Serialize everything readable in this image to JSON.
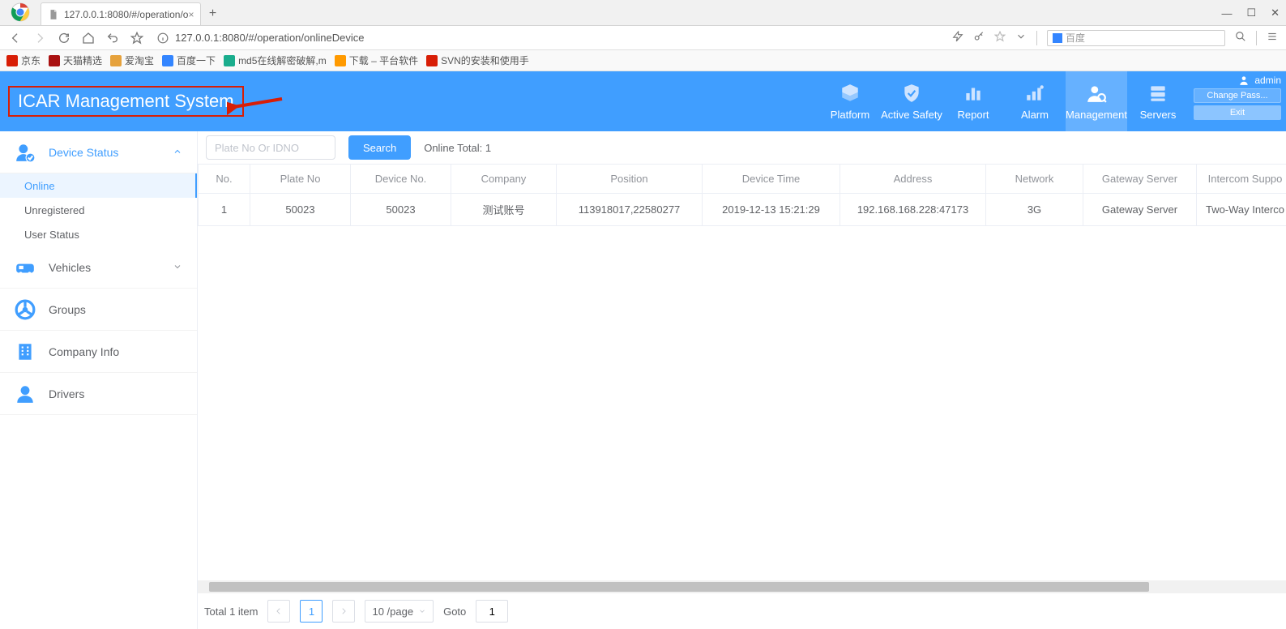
{
  "browser": {
    "tab_title": "127.0.0.1:8080/#/operation/o",
    "url": "127.0.0.1:8080/#/operation/onlineDevice",
    "search_engine": "百度",
    "bookmarks": [
      "京东",
      "天猫精选",
      "爱淘宝",
      "百度一下",
      "md5在线解密破解,m",
      "下载 – 平台软件",
      "SVN的安装和使用手"
    ]
  },
  "header": {
    "title": "ICAR Management System",
    "nav": [
      "Platform",
      "Active Safety",
      "Report",
      "Alarm",
      "Management",
      "Servers"
    ],
    "user": {
      "name": "admin",
      "change_pass": "Change Pass...",
      "exit": "Exit"
    }
  },
  "sidebar": {
    "device_status": {
      "label": "Device Status",
      "items": [
        "Online",
        "Unregistered",
        "User Status"
      ]
    },
    "vehicles": "Vehicles",
    "groups": "Groups",
    "company_info": "Company Info",
    "drivers": "Drivers"
  },
  "toolbar": {
    "placeholder": "Plate No Or IDNO",
    "search": "Search",
    "online_total_label": "Online Total:",
    "online_total_value": "1"
  },
  "table": {
    "headers": [
      "No.",
      "Plate No",
      "Device No.",
      "Company",
      "Position",
      "Device Time",
      "Address",
      "Network",
      "Gateway Server",
      "Intercom Suppo"
    ],
    "rows": [
      {
        "no": "1",
        "plate": "50023",
        "device": "50023",
        "company": "测试账号",
        "position": "113918017,22580277",
        "time": "2019-12-13 15:21:29",
        "address": "192.168.168.228:47173",
        "network": "3G",
        "gateway": "Gateway Server",
        "intercom": "Two-Way Interco"
      }
    ]
  },
  "pager": {
    "total_label": "Total 1 item",
    "current": "1",
    "size": "10 /page",
    "goto_label": "Goto",
    "goto_value": "1"
  }
}
